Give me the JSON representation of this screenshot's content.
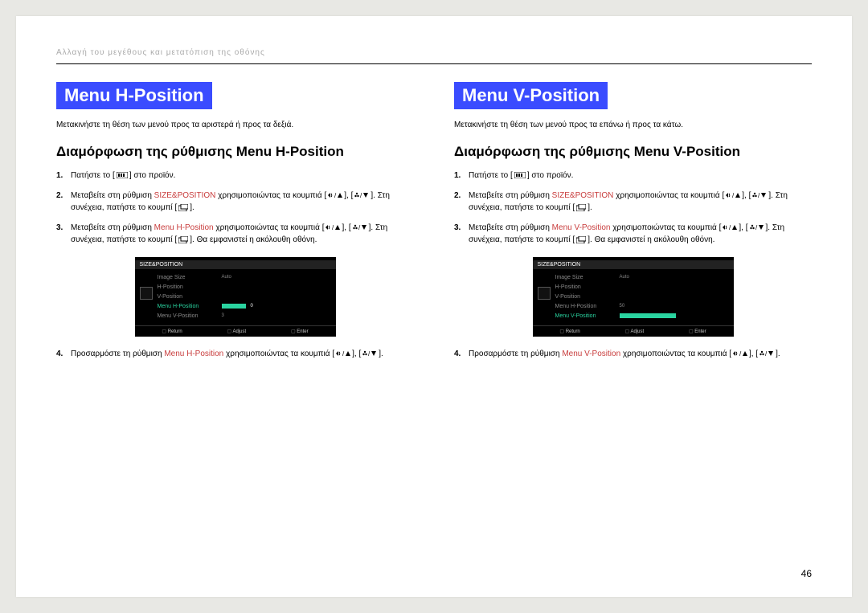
{
  "header": "Αλλαγή του μεγέθους και μετατόπιση της οθόνης",
  "page_number": "46",
  "common": {
    "step1_pre": "Πατήστε το [",
    "step1_post": "] στο προϊόν.",
    "step2_pre": "Μεταβείτε στη ρύθμιση ",
    "step2_kw": "SIZE&POSITION",
    "step2_mid": " χρησιμοποιώντας τα κουμπιά [",
    "step2_sep": "], [",
    "step2_end": "]. Στη συνέχεια, πατήστε το κουμπί [",
    "step2_close": "].",
    "step3_pre": "Μεταβείτε στη ρύθμιση ",
    "step3_mid": " χρησιμοποιώντας τα κουμπιά [",
    "step3_sep": "], [",
    "step3_end": "]. Στη συνέχεια, πατήστε το κουμπί [",
    "step3_after": "].  Θα εμφανιστεί η ακόλουθη οθόνη.",
    "step4_pre": "Προσαρμόστε τη ρύθμιση ",
    "step4_mid": " χρησιμοποιώντας τα κουμπιά [",
    "step4_sep": "], [",
    "step4_close": "]."
  },
  "left": {
    "title": "Menu H-Position",
    "intro": "Μετακινήστε τη θέση των μενού προς τα αριστερά ή προς τα δεξιά.",
    "subhead": "Διαμόρφωση της ρύθμισης Menu H-Position",
    "kw": "Menu H-Position",
    "osd": {
      "title": "SIZE&POSITION",
      "rows": [
        {
          "label": "Image Size",
          "value": "Auto"
        },
        {
          "label": "H-Position",
          "value": ""
        },
        {
          "label": "V-Position",
          "value": ""
        },
        {
          "label": "Menu H-Position",
          "value": "0",
          "hl": true,
          "bar": "bar0"
        },
        {
          "label": "Menu V-Position",
          "value": "3"
        }
      ],
      "footer": [
        "Return",
        "Adjust",
        "Enter"
      ]
    }
  },
  "right": {
    "title": "Menu V-Position",
    "intro": "Μετακινήστε τη θέση των μενού προς τα επάνω ή προς τα κάτω.",
    "subhead": "Διαμόρφωση της ρύθμισης Menu V-Position",
    "kw": "Menu V-Position",
    "osd": {
      "title": "SIZE&POSITION",
      "rows": [
        {
          "label": "Image Size",
          "value": "Auto"
        },
        {
          "label": "H-Position",
          "value": ""
        },
        {
          "label": "V-Position",
          "value": ""
        },
        {
          "label": "Menu H-Position",
          "value": "50"
        },
        {
          "label": "Menu V-Position",
          "value": "",
          "hl": true,
          "bar": ""
        }
      ],
      "footer": [
        "Return",
        "Adjust",
        "Enter"
      ]
    }
  }
}
